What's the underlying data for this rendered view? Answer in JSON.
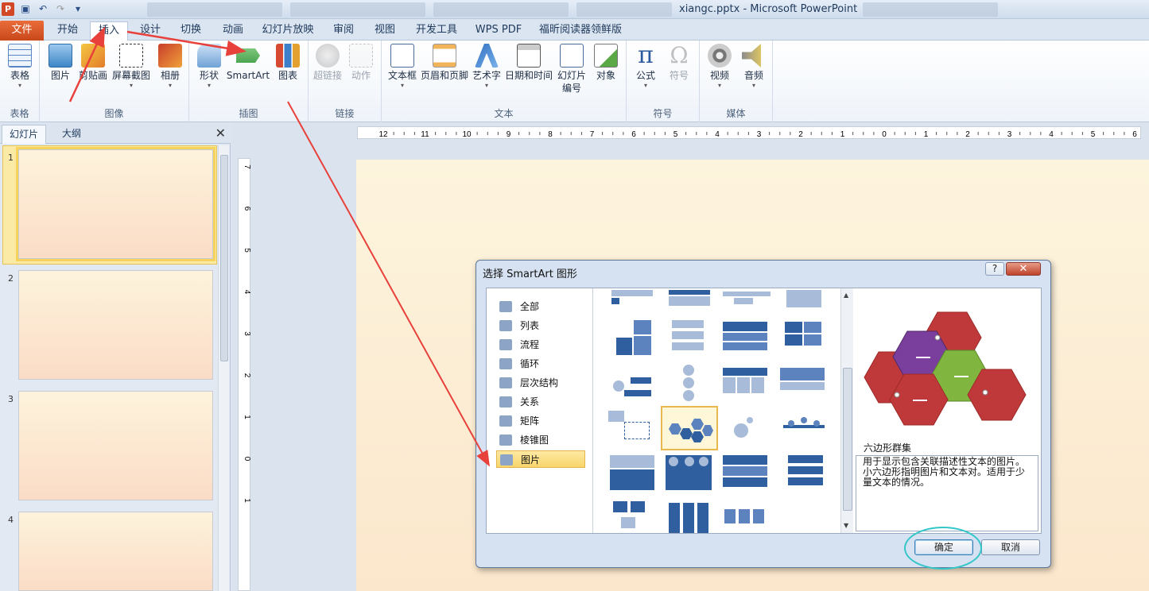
{
  "window": {
    "title": "xiangc.pptx - Microsoft PowerPoint",
    "app_icon": "P"
  },
  "tabs": [
    {
      "label": "文件"
    },
    {
      "label": "开始"
    },
    {
      "label": "插入"
    },
    {
      "label": "设计"
    },
    {
      "label": "切换"
    },
    {
      "label": "动画"
    },
    {
      "label": "幻灯片放映"
    },
    {
      "label": "审阅"
    },
    {
      "label": "视图"
    },
    {
      "label": "开发工具"
    },
    {
      "label": "WPS PDF"
    },
    {
      "label": "福昕阅读器领鲜版"
    }
  ],
  "ribbon": {
    "groups": [
      {
        "label": "表格"
      },
      {
        "label": "图像"
      },
      {
        "label": "插图"
      },
      {
        "label": "链接"
      },
      {
        "label": "文本"
      },
      {
        "label": "符号"
      },
      {
        "label": "媒体"
      }
    ],
    "buttons": {
      "table": "表格",
      "picture": "图片",
      "clipart": "剪贴画",
      "screenshot": "屏幕截图",
      "album": "相册",
      "shapes": "形状",
      "smartart": "SmartArt",
      "chart": "图表",
      "hyperlink": "超链接",
      "action": "动作",
      "textbox": "文本框",
      "header_footer": "页眉和页脚",
      "wordart": "艺术字",
      "datetime": "日期和时间",
      "slide_number_1": "幻灯片",
      "slide_number_2": "编号",
      "object": "对象",
      "equation": "公式",
      "symbol": "符号",
      "video": "视频",
      "audio": "音频",
      "dropdown_arrow": "▾"
    }
  },
  "left_panel": {
    "tabs": [
      {
        "label": "幻灯片"
      },
      {
        "label": "大纲"
      }
    ],
    "close": "✕",
    "slide_numbers": [
      "1",
      "2",
      "3",
      "4"
    ]
  },
  "ruler": {
    "horizontal": [
      "12",
      "11",
      "10",
      "9",
      "8",
      "7",
      "6",
      "5",
      "4",
      "3",
      "2",
      "1",
      "0",
      "1",
      "2",
      "3",
      "4",
      "5",
      "6",
      "7",
      "8",
      "9",
      "10",
      "11",
      "12"
    ],
    "vertical": [
      "7",
      "6",
      "5",
      "4",
      "3",
      "2",
      "1",
      "0",
      "1"
    ]
  },
  "dialog": {
    "title": "选择 SmartArt 图形",
    "help": "?",
    "close": "✕",
    "categories": [
      {
        "label": "全部"
      },
      {
        "label": "列表"
      },
      {
        "label": "流程"
      },
      {
        "label": "循环"
      },
      {
        "label": "层次结构"
      },
      {
        "label": "关系"
      },
      {
        "label": "矩阵"
      },
      {
        "label": "棱锥图"
      },
      {
        "label": "图片"
      }
    ],
    "selected_category": "图片",
    "preview_title": "六边形群集",
    "preview_desc": "用于显示包含关联描述性文本的图片。小六边形指明图片和文本对。适用于少量文本的情况。",
    "ok": "确定",
    "cancel": "取消"
  },
  "colors": {
    "accent": "#c9481b",
    "annotation": "#e8403a",
    "highlight": "#34c6c8"
  }
}
